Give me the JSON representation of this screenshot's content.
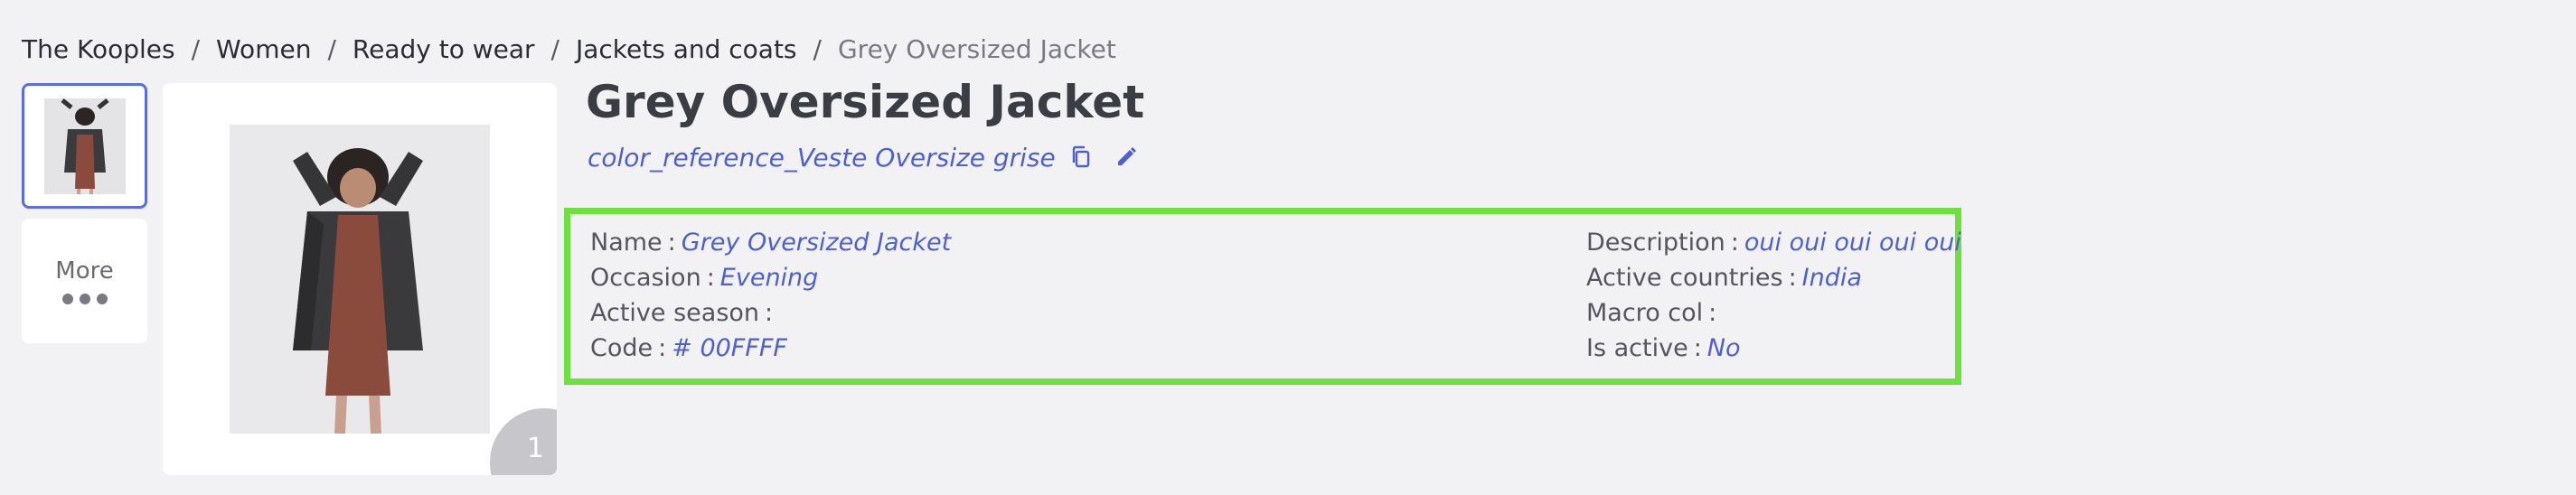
{
  "breadcrumb": {
    "items": [
      "The Kooples",
      "Women",
      "Ready to wear",
      "Jackets and coats"
    ],
    "current": "Grey Oversized Jacket",
    "separator": "/"
  },
  "gallery": {
    "more_label": "More",
    "image_index": "1"
  },
  "product": {
    "title": "Grey Oversized Jacket",
    "color_reference": "color_reference_Veste Oversize grise"
  },
  "details": {
    "left": [
      {
        "label": "Name",
        "value": "Grey Oversized Jacket"
      },
      {
        "label": "Occasion",
        "value": "Evening"
      },
      {
        "label": "Active season",
        "value": ""
      },
      {
        "label": "Code",
        "value": "# 00FFFF"
      }
    ],
    "right": [
      {
        "label": "Description",
        "value": "oui oui oui oui oui"
      },
      {
        "label": "Active countries",
        "value": "India"
      },
      {
        "label": "Macro col",
        "value": ""
      },
      {
        "label": "Is active",
        "value": "No"
      }
    ]
  },
  "icons": {
    "copy": "copy-icon",
    "edit": "pencil-icon",
    "more": "ellipsis-icon"
  },
  "colors": {
    "accent": "#4f5fcf",
    "highlight_border": "#6ee040",
    "selected_thumb_border": "#5b6ee0",
    "background": "#f2f2f5"
  }
}
